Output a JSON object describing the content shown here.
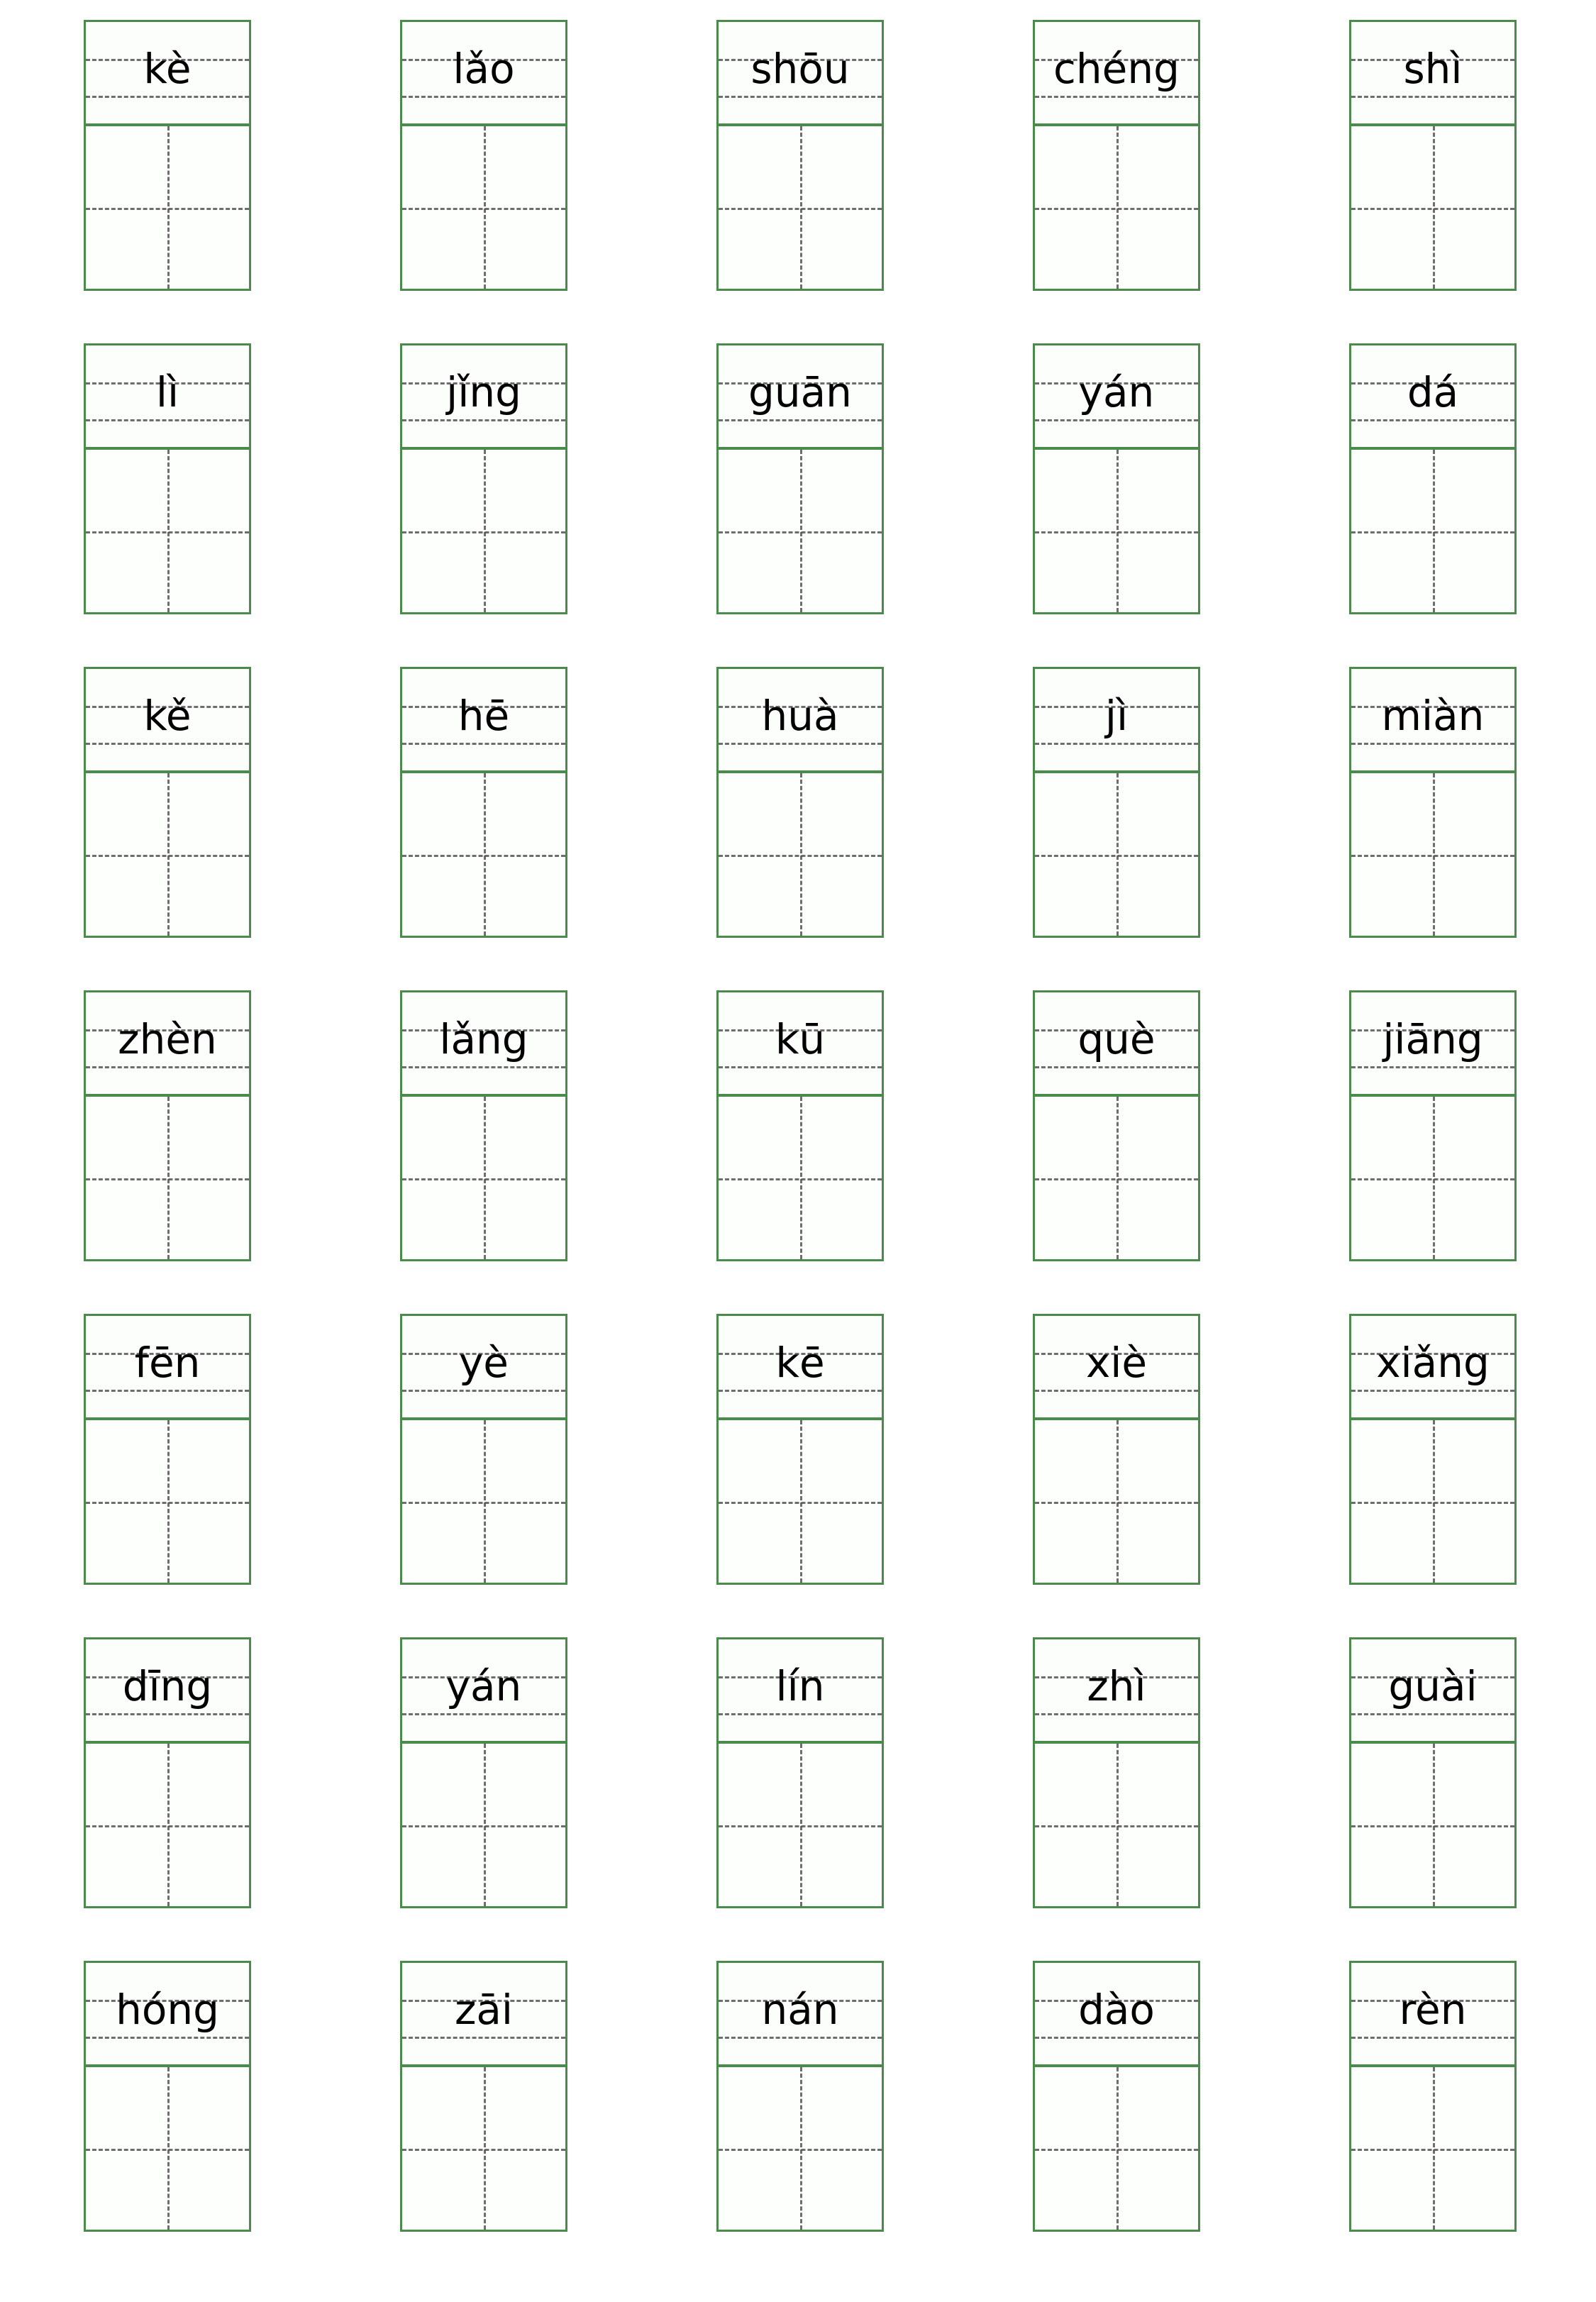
{
  "worksheet": {
    "title": "Pinyin to Chinese Character Writing Practice Worksheet",
    "columns": 5,
    "rows": 7,
    "colors": {
      "grid_border": "#4a8a4a",
      "guide_line": "#555555",
      "cell_background": "#fbfefb",
      "page_background": "#ffffff",
      "text": "#000000"
    },
    "cell_structure": {
      "pinyin_box_name": "four-line pinyin box",
      "character_box_name": "tian zi ge",
      "character_value": ""
    }
  },
  "entries": [
    [
      {
        "pinyin": "kè",
        "character": ""
      },
      {
        "pinyin": "lǎo",
        "character": ""
      },
      {
        "pinyin": "shōu",
        "character": ""
      },
      {
        "pinyin": "chéng",
        "character": ""
      },
      {
        "pinyin": "shì",
        "character": ""
      }
    ],
    [
      {
        "pinyin": "lì",
        "character": ""
      },
      {
        "pinyin": "jǐng",
        "character": ""
      },
      {
        "pinyin": "guān",
        "character": ""
      },
      {
        "pinyin": "yán",
        "character": ""
      },
      {
        "pinyin": "dá",
        "character": ""
      }
    ],
    [
      {
        "pinyin": "kě",
        "character": ""
      },
      {
        "pinyin": "hē",
        "character": ""
      },
      {
        "pinyin": "huà",
        "character": ""
      },
      {
        "pinyin": "jì",
        "character": ""
      },
      {
        "pinyin": "miàn",
        "character": ""
      }
    ],
    [
      {
        "pinyin": "zhèn",
        "character": ""
      },
      {
        "pinyin": "lǎng",
        "character": ""
      },
      {
        "pinyin": "kū",
        "character": ""
      },
      {
        "pinyin": "què",
        "character": ""
      },
      {
        "pinyin": "jiāng",
        "character": ""
      }
    ],
    [
      {
        "pinyin": "fēn",
        "character": ""
      },
      {
        "pinyin": "yè",
        "character": ""
      },
      {
        "pinyin": "kē",
        "character": ""
      },
      {
        "pinyin": "xiè",
        "character": ""
      },
      {
        "pinyin": "xiǎng",
        "character": ""
      }
    ],
    [
      {
        "pinyin": "dīng",
        "character": ""
      },
      {
        "pinyin": "yán",
        "character": ""
      },
      {
        "pinyin": "lín",
        "character": ""
      },
      {
        "pinyin": "zhì",
        "character": ""
      },
      {
        "pinyin": "guài",
        "character": ""
      }
    ],
    [
      {
        "pinyin": "hóng",
        "character": ""
      },
      {
        "pinyin": "zāi",
        "character": ""
      },
      {
        "pinyin": "nán",
        "character": ""
      },
      {
        "pinyin": "dào",
        "character": ""
      },
      {
        "pinyin": "rèn",
        "character": ""
      }
    ]
  ]
}
